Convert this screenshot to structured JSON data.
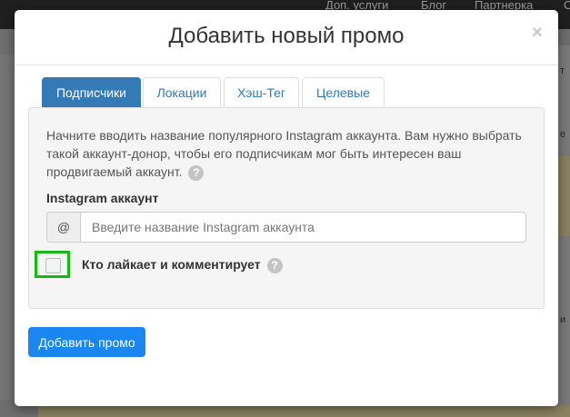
{
  "background": {
    "nav_links": [
      "Доп. услуги",
      "Блог",
      "Партнерка",
      "С"
    ],
    "side_fragments": [
      "т",
      "е",
      "и"
    ]
  },
  "modal": {
    "title": "Добавить новый промо",
    "close_glyph": "×",
    "tabs": [
      {
        "label": "Подписчики",
        "active": true
      },
      {
        "label": "Локации",
        "active": false
      },
      {
        "label": "Хэш-Тег",
        "active": false
      },
      {
        "label": "Целевые",
        "active": false
      }
    ],
    "description": "Начните вводить название популярного Instagram аккаунта. Вам нужно выбрать такой аккаунт-донор, чтобы его подписчикам мог быть интересен ваш продвигаемый аккаунт.",
    "help_glyph": "?",
    "account_label": "Instagram аккаунт",
    "input_addon": "@",
    "input_placeholder": "Введите название Instagram аккаунта",
    "input_value": "",
    "checkbox_label": "Кто лайкает и комментирует",
    "checkbox_checked": false,
    "submit_label": "Добавить промо"
  },
  "colors": {
    "tab_active": "#337ab7",
    "primary_button": "#1a86f2",
    "checkbox_highlight": "#15b815"
  }
}
